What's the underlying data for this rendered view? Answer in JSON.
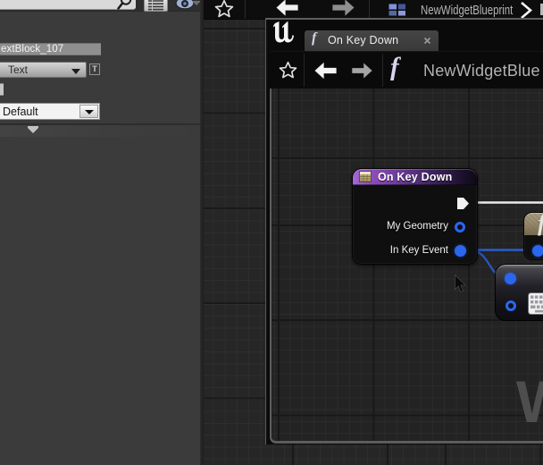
{
  "colors": {
    "panel_bg": "#3b3b3b",
    "graph_bg": "#232323",
    "toolbar_bg": "#0d0d0d",
    "node_header_purple": "#8c4cbd",
    "pin_blue": "#2b66ee",
    "exec_wire_white": "#eaeaea",
    "wire_blue": "#2a5cd0",
    "tab_bg": "#3e3e3e"
  },
  "left_panel": {
    "name_field": {
      "value": "extBlock_107"
    },
    "font_combo": {
      "value": "Text"
    },
    "t_button": {
      "label": "T"
    },
    "default_combo": {
      "value": "Default"
    }
  },
  "main_toolbar": {
    "breadcrumb": "NewWidgetBlueprint",
    "chevron": ">"
  },
  "window": {
    "logo": "u",
    "tab": {
      "icon": "f",
      "label": "On Key Down",
      "close": "x"
    },
    "toolbar": {
      "function_icon": "f",
      "title": "NewWidgetBlue"
    },
    "graph": {
      "watermark": "W",
      "nodes": {
        "on_key_down": {
          "title": "On Key Down",
          "pins": [
            {
              "label": "My Geometry",
              "type": "struct",
              "connected": false
            },
            {
              "label": "In Key Event",
              "type": "struct",
              "connected": true
            }
          ]
        },
        "function_node": {
          "icon": "f"
        },
        "keyboard_node": {
          "icon": "keyboard"
        }
      }
    }
  }
}
